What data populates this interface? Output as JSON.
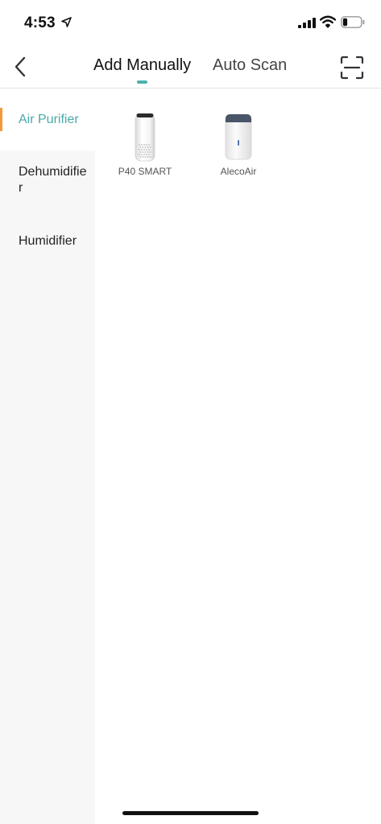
{
  "status_bar": {
    "time": "4:53",
    "icons": [
      "location-arrow-icon",
      "cellular-signal-icon",
      "wifi-icon",
      "battery-icon"
    ],
    "battery_level": 0.25
  },
  "header": {
    "back_icon": "chevron-left-icon",
    "tabs": [
      {
        "label": "Add Manually",
        "active": true
      },
      {
        "label": "Auto Scan",
        "active": false
      }
    ],
    "scan_icon": "qr-scan-icon",
    "accent_color": "#4cb1ae"
  },
  "sidebar": {
    "items": [
      {
        "label": "Air Purifier",
        "active": true
      },
      {
        "label": "Dehumidifier",
        "active": false
      },
      {
        "label": "Humidifier",
        "active": false
      }
    ],
    "active_text_color": "#4aa9a9",
    "active_marker_color": "#f29a3a"
  },
  "devices": [
    {
      "label": "P40 SMART",
      "image": "air-purifier-tower"
    },
    {
      "label": "AlecoAir",
      "image": "dehumidifier-box"
    }
  ]
}
